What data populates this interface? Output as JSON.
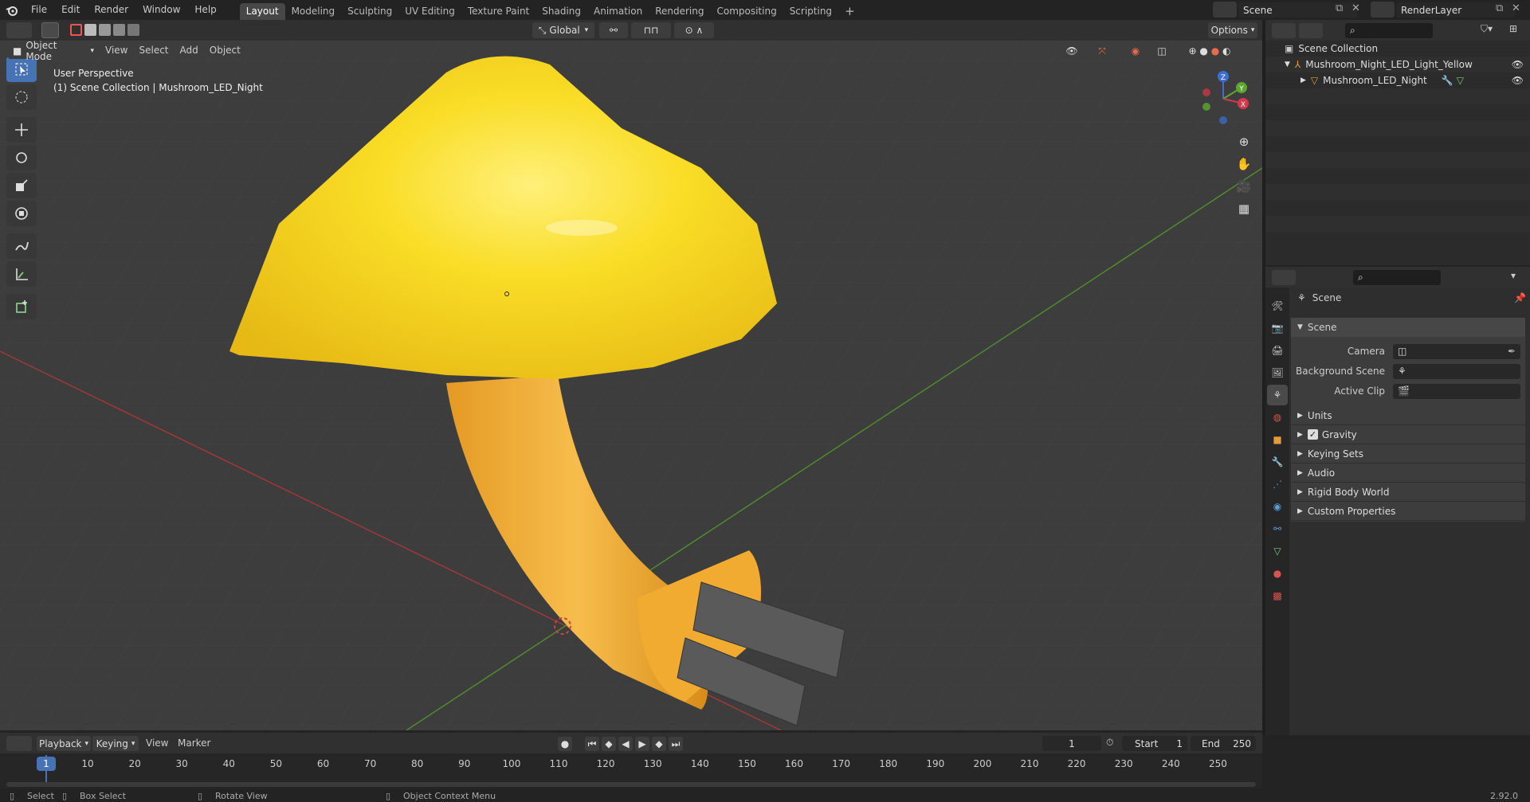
{
  "top_menu": [
    "File",
    "Edit",
    "Render",
    "Window",
    "Help"
  ],
  "workspace_tabs": [
    "Layout",
    "Modeling",
    "Sculpting",
    "UV Editing",
    "Texture Paint",
    "Shading",
    "Animation",
    "Rendering",
    "Compositing",
    "Scripting"
  ],
  "active_tab": "Layout",
  "scene_field": "Scene",
  "renderlayer_field": "RenderLayer",
  "viewport": {
    "transform_orientation": "Global",
    "options_label": "Options",
    "mode_label": "Object Mode",
    "header_menus": [
      "View",
      "Select",
      "Add",
      "Object"
    ],
    "overlay_title": "User Perspective",
    "overlay_collection": "(1) Scene Collection | Mushroom_LED_Night",
    "gizmo_axes": {
      "x": "X",
      "y": "Y",
      "z": "Z"
    }
  },
  "outliner": {
    "root": "Scene Collection",
    "items": [
      {
        "name": "Mushroom_Night_LED_Light_Yellow"
      },
      {
        "name": "Mushroom_LED_Night"
      }
    ]
  },
  "properties": {
    "context_title": "Scene",
    "panel_title": "Scene",
    "fields": [
      {
        "label": "Camera"
      },
      {
        "label": "Background Scene"
      },
      {
        "label": "Active Clip"
      }
    ],
    "subpanels": [
      "Units",
      "Gravity",
      "Keying Sets",
      "Audio",
      "Rigid Body World",
      "Custom Properties"
    ],
    "gravity_checked": true
  },
  "timeline": {
    "menus": [
      "Playback",
      "Keying",
      "View",
      "Marker"
    ],
    "current_frame": "1",
    "start_label": "Start",
    "start_value": "1",
    "end_label": "End",
    "end_value": "250",
    "ticks": [
      "10",
      "20",
      "30",
      "40",
      "50",
      "60",
      "70",
      "80",
      "90",
      "100",
      "110",
      "120",
      "130",
      "140",
      "150",
      "160",
      "170",
      "180",
      "190",
      "200",
      "210",
      "220",
      "230",
      "240",
      "250"
    ],
    "playhead_label": "1"
  },
  "statusbar": {
    "items": [
      "Select",
      "Box Select",
      "Rotate View",
      "Object Context Menu"
    ],
    "version": "2.92.0"
  }
}
